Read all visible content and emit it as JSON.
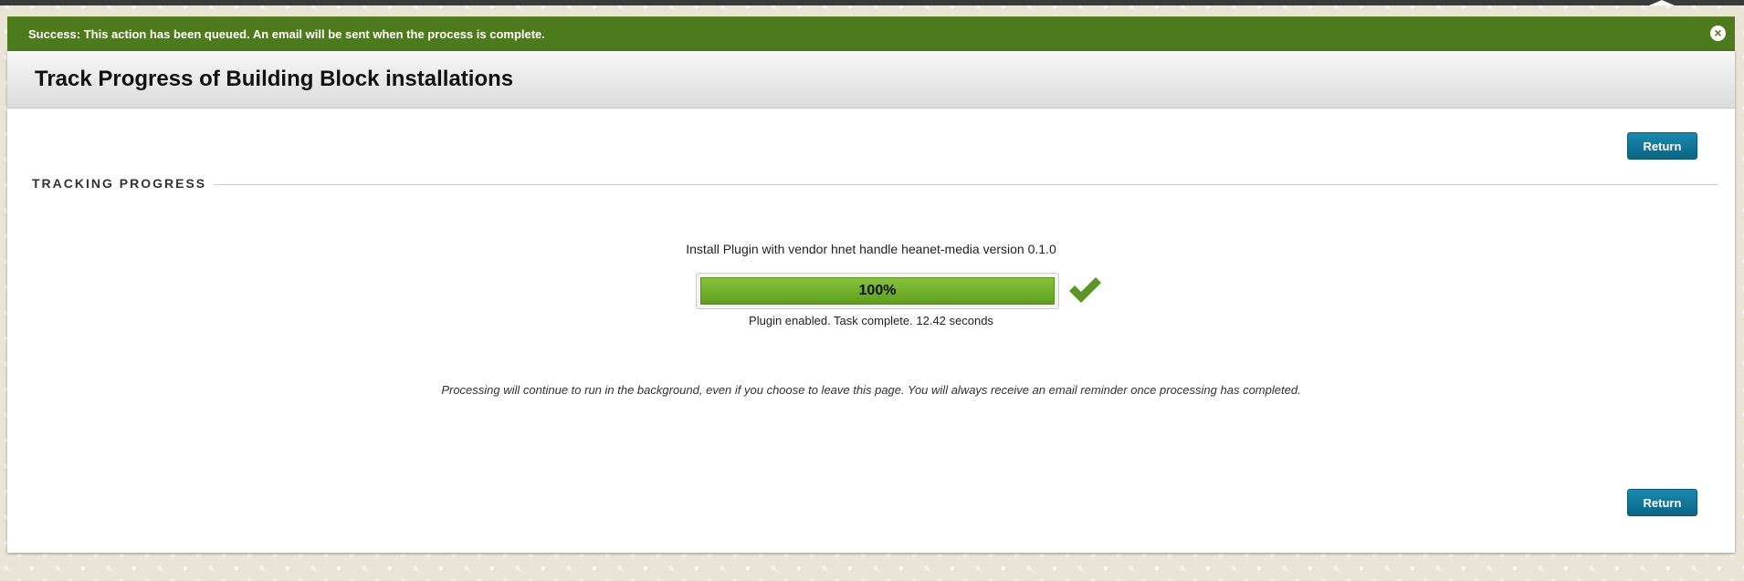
{
  "alert": {
    "message": "Success: This action has been queued. An email will be sent when the process is complete.",
    "close_icon": "close-circle-icon"
  },
  "page": {
    "title": "Track Progress of Building Block installations"
  },
  "actions": {
    "return_label": "Return"
  },
  "section": {
    "title": "TRACKING PROGRESS"
  },
  "task": {
    "label": "Install Plugin with vendor hnet handle heanet-media version 0.1.0",
    "progress_percent": 100,
    "progress_text": "100%",
    "status": "Plugin enabled. Task complete. 12.42 seconds",
    "status_icon": "checkmark-icon"
  },
  "note": "Processing will continue to run in the background, even if you choose to leave this page. You will always receive an email reminder once processing has completed.",
  "colors": {
    "alert_bg": "#4d7a1c",
    "button": "#0a6485",
    "progress": "#6aab24",
    "check": "#5a9424"
  }
}
